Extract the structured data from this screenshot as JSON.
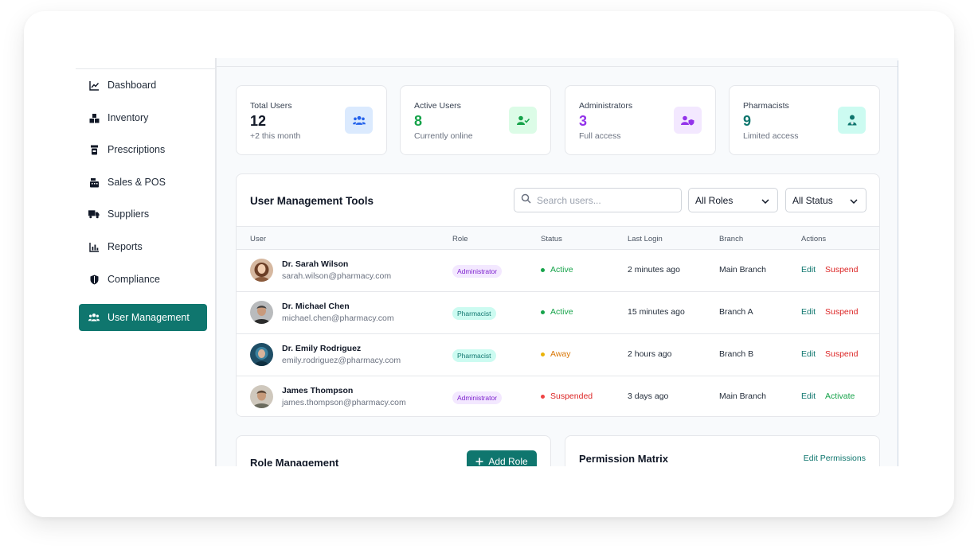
{
  "sidebar": {
    "items": [
      {
        "label": "Dashboard",
        "icon": "chart-line-icon"
      },
      {
        "label": "Inventory",
        "icon": "boxes-icon"
      },
      {
        "label": "Prescriptions",
        "icon": "pill-bottle-icon"
      },
      {
        "label": "Sales & POS",
        "icon": "cash-register-icon"
      },
      {
        "label": "Suppliers",
        "icon": "truck-icon"
      },
      {
        "label": "Reports",
        "icon": "bar-chart-icon"
      },
      {
        "label": "Compliance",
        "icon": "shield-icon"
      },
      {
        "label": "User Management",
        "icon": "users-icon",
        "active": true
      }
    ]
  },
  "stats": [
    {
      "label": "Total Users",
      "value": "12",
      "sub": "+2 this month",
      "color": "#111827",
      "icon": "users-icon",
      "badge_bg": "#dbeafe",
      "badge_fg": "#2563eb"
    },
    {
      "label": "Active Users",
      "value": "8",
      "sub": "Currently online",
      "color": "#16a34a",
      "icon": "user-check-icon",
      "badge_bg": "#dcfce7",
      "badge_fg": "#16a34a"
    },
    {
      "label": "Administrators",
      "value": "3",
      "sub": "Full access",
      "color": "#9333ea",
      "icon": "user-shield-icon",
      "badge_bg": "#f3e8ff",
      "badge_fg": "#9333ea"
    },
    {
      "label": "Pharmacists",
      "value": "9",
      "sub": "Limited access",
      "color": "#0f766e",
      "icon": "user-doctor-icon",
      "badge_bg": "#ccfbf1",
      "badge_fg": "#0f766e"
    }
  ],
  "tools": {
    "title": "User Management Tools",
    "search_placeholder": "Search users...",
    "role_filter": "All Roles",
    "status_filter": "All Status"
  },
  "table": {
    "headers": [
      "User",
      "Role",
      "Status",
      "Last Login",
      "Branch",
      "Actions"
    ],
    "rows": [
      {
        "name": "Dr. Sarah Wilson",
        "email": "sarah.wilson@pharmacy.com",
        "role": "Administrator",
        "status": "Active",
        "last_login": "2 minutes ago",
        "branch": "Main Branch",
        "edit": "Edit",
        "action": "Suspend"
      },
      {
        "name": "Dr. Michael Chen",
        "email": "michael.chen@pharmacy.com",
        "role": "Pharmacist",
        "status": "Active",
        "last_login": "15 minutes ago",
        "branch": "Branch A",
        "edit": "Edit",
        "action": "Suspend"
      },
      {
        "name": "Dr. Emily Rodriguez",
        "email": "emily.rodriguez@pharmacy.com",
        "role": "Pharmacist",
        "status": "Away",
        "last_login": "2 hours ago",
        "branch": "Branch B",
        "edit": "Edit",
        "action": "Suspend"
      },
      {
        "name": "James Thompson",
        "email": "james.thompson@pharmacy.com",
        "role": "Administrator",
        "status": "Suspended",
        "last_login": "3 days ago",
        "branch": "Main Branch",
        "edit": "Edit",
        "action": "Activate"
      }
    ]
  },
  "role_management": {
    "title": "Role Management",
    "add_label": "Add Role"
  },
  "permission_matrix": {
    "title": "Permission Matrix",
    "edit_label": "Edit Permissions"
  },
  "colors": {
    "accent": "#0f766e",
    "active": "#16a34a",
    "away": "#d97706",
    "suspended": "#dc2626"
  }
}
